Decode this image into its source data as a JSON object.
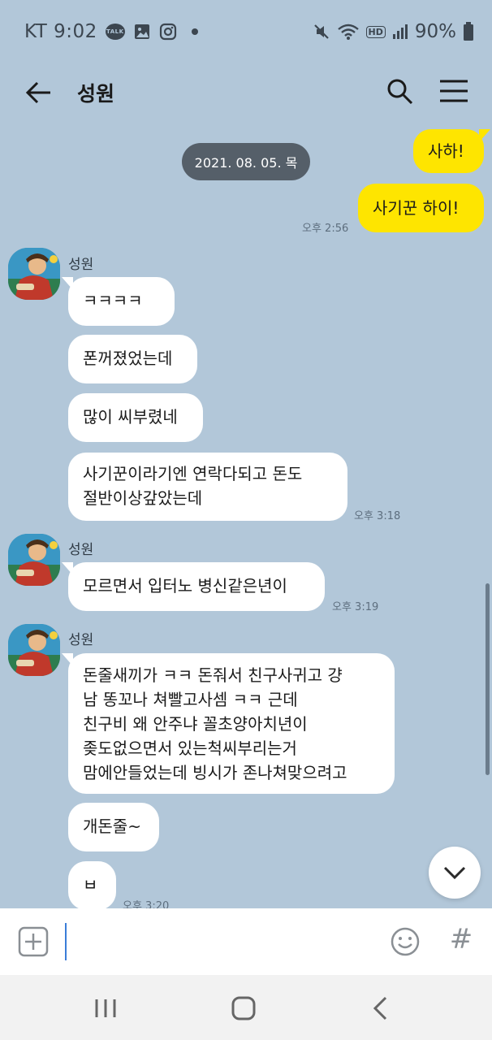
{
  "status_bar": {
    "carrier_time": "KT 9:02",
    "talk_label": "TALK",
    "battery": "90%",
    "hd_label": "HD"
  },
  "header": {
    "title": "성원"
  },
  "date_chip": "2021. 08. 05. 목",
  "messages_mine": [
    {
      "text": "사하!"
    },
    {
      "text": "사기꾼 하이!"
    }
  ],
  "mine_time": "오후 2:56",
  "groups": [
    {
      "sender": "성원",
      "messages": [
        "ㅋㅋㅋㅋ",
        "폰꺼졌었는데",
        "많이 씨부렸네",
        "사기꾼이라기엔 연락다되고 돈도\n절반이상갚았는데"
      ],
      "time": "오후 3:18"
    },
    {
      "sender": "성원",
      "messages": [
        "모르면서 입터노 병신같은년이"
      ],
      "time": "오후 3:19"
    },
    {
      "sender": "성원",
      "messages": [
        "돈줄새끼가 ㅋㅋ 돈줘서 친구사귀고 걍\n남 똥꼬나 쳐빨고사셈 ㅋㅋ 근데\n친구비 왜 안주냐 꼴초양아치년이\n좆도없으면서 있는척씨부리는거\n맘에안들었는데 빙시가 존나쳐맞으려고",
        "개돈줄~",
        "ㅂ"
      ],
      "time": "오후 3:20"
    }
  ],
  "input": {
    "value": "",
    "hash_label": "#"
  }
}
